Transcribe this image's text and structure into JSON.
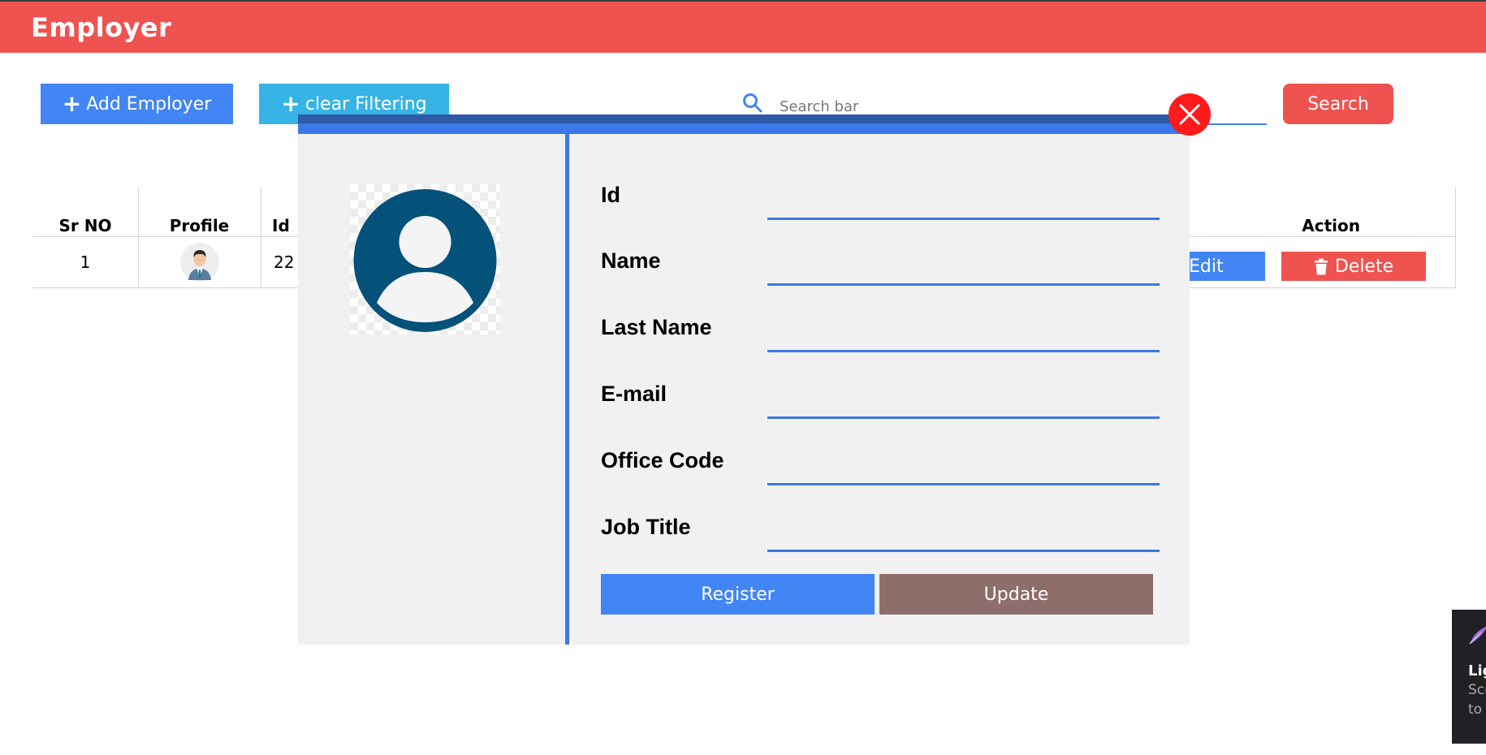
{
  "header": {
    "title": "Employer"
  },
  "toolbar": {
    "add_label": "Add Employer",
    "clear_label": "clear Filtering",
    "search_placeholder": "Search bar",
    "search_button": "Search"
  },
  "table": {
    "columns": [
      "Sr NO",
      "Profile",
      "Id",
      "Action"
    ],
    "rows": [
      {
        "sr_no": "1",
        "profile": "avatar",
        "id": "22",
        "edit_label": "Edit",
        "delete_label": "Delete"
      }
    ]
  },
  "modal": {
    "fields": [
      {
        "label": "Id",
        "value": ""
      },
      {
        "label": "Name",
        "value": ""
      },
      {
        "label": "Last Name",
        "value": ""
      },
      {
        "label": "E-mail",
        "value": ""
      },
      {
        "label": "Office Code",
        "value": ""
      },
      {
        "label": "Job Title",
        "value": ""
      }
    ],
    "register_label": "Register",
    "update_label": "Update"
  },
  "toast": {
    "title": "Lig",
    "lines": [
      "Scr",
      "to"
    ]
  },
  "colors": {
    "header": "#ef5350",
    "primary": "#4285f4",
    "secondary": "#36b4e5",
    "danger": "#ef5350",
    "update": "#8d6e6a",
    "avatar": "#04527a"
  }
}
